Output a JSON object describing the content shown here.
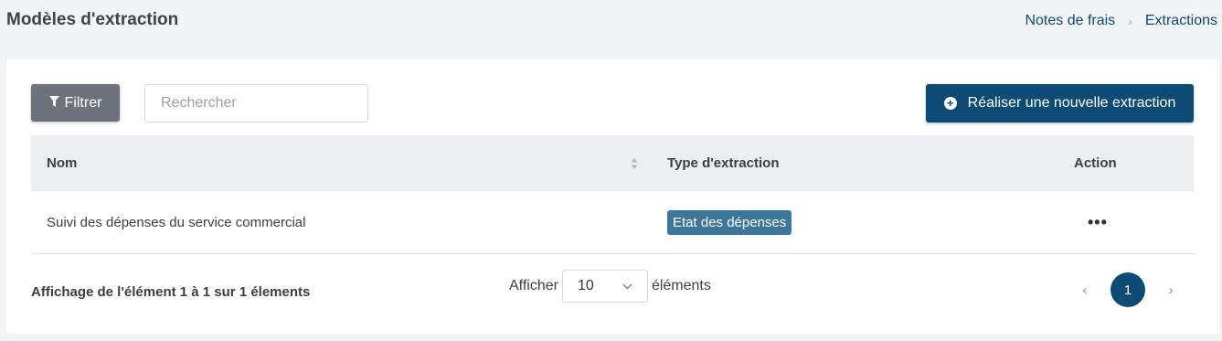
{
  "header": {
    "title": "Modèles d'extraction",
    "breadcrumb": [
      "Notes de frais",
      "Extractions"
    ]
  },
  "toolbar": {
    "filter_label": "Filtrer",
    "search_placeholder": "Rechercher",
    "new_extraction_label": "Réaliser une nouvelle extraction"
  },
  "table": {
    "columns": [
      "Nom",
      "Type d'extraction",
      "Action"
    ],
    "rows": [
      {
        "name": "Suivi des dépenses du service commercial",
        "type": "Etat des dépenses",
        "action_icon": "more-horizontal-icon"
      }
    ]
  },
  "footer": {
    "info": "Affichage de l'élément 1 à 1 sur 1 élements",
    "length_prefix": "Afficher",
    "length_value": "10",
    "length_suffix": "éléments",
    "current_page": "1"
  },
  "icons": {
    "filter": "funnel-icon",
    "add": "plus-circle-icon",
    "sort": "sort-icon",
    "dropdown": "chevron-down-icon",
    "prev": "chevron-left-icon",
    "next": "chevron-right-icon"
  },
  "colors": {
    "primary": "#0b4b74",
    "filter_button": "#6c737c",
    "badge": "#3d7699",
    "background": "#f3f4f8"
  }
}
